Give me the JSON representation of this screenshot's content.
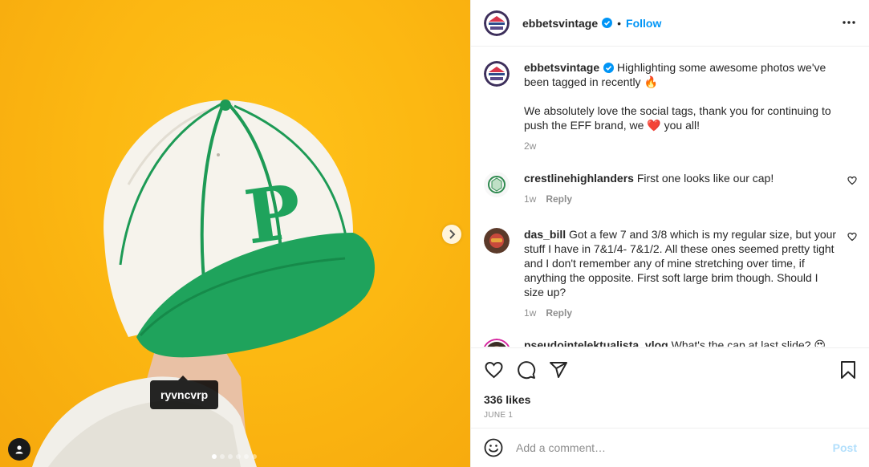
{
  "photo": {
    "tag_username": "ryvncvrp",
    "slide_count": 6,
    "active_slide": 1,
    "icons": {
      "next": "chevron-right-icon",
      "user_tags": "user-icon"
    },
    "colors": {
      "background": "#fcb812",
      "cap_crown": "#f4f1e8",
      "cap_brim": "#1fa35c",
      "cap_logo": "#1d9a55"
    }
  },
  "post_header": {
    "username": "ebbetsvintage",
    "verified": true,
    "separator": "•",
    "follow_label": "Follow",
    "more_icon": "more-options-icon"
  },
  "caption": {
    "username": "ebbetsvintage",
    "paragraph_1": "Highlighting some awesome photos we've been tagged in recently 🔥",
    "paragraph_2": "We absolutely love the social tags, thank you for continuing to push the EFF brand, we ❤️ you all!",
    "time": "2w"
  },
  "comments": [
    {
      "username": "crestlinehighlanders",
      "text": "First one looks like our cap!",
      "time": "1w",
      "reply_label": "Reply"
    },
    {
      "username": "das_bill",
      "text": "Got a few 7 and 3/8 which is my regular size, but your stuff I have in 7&1/4- 7&1/2. All these ones seemed pretty tight and I don't remember any of mine stretching over time, if anything the opposite. First soft large brim though. Should I size up?",
      "time": "1w",
      "reply_label": "Reply"
    },
    {
      "username": "pseudointelektualista_vlog",
      "text": "What's the cap at last slide? 😍",
      "time": "",
      "reply_label": ""
    }
  ],
  "actions": {
    "likes": "336 likes",
    "date": "JUNE 1",
    "icons": [
      "like-icon",
      "comment-icon",
      "share-icon",
      "save-icon"
    ]
  },
  "add_comment": {
    "placeholder": "Add a comment…",
    "post_label": "Post",
    "emoji_icon": "emoji-icon"
  },
  "colors": {
    "accent": "#0095f6",
    "post_disabled": "#b2dffc",
    "muted": "#8e8e8e",
    "heart": "#ed4956"
  }
}
